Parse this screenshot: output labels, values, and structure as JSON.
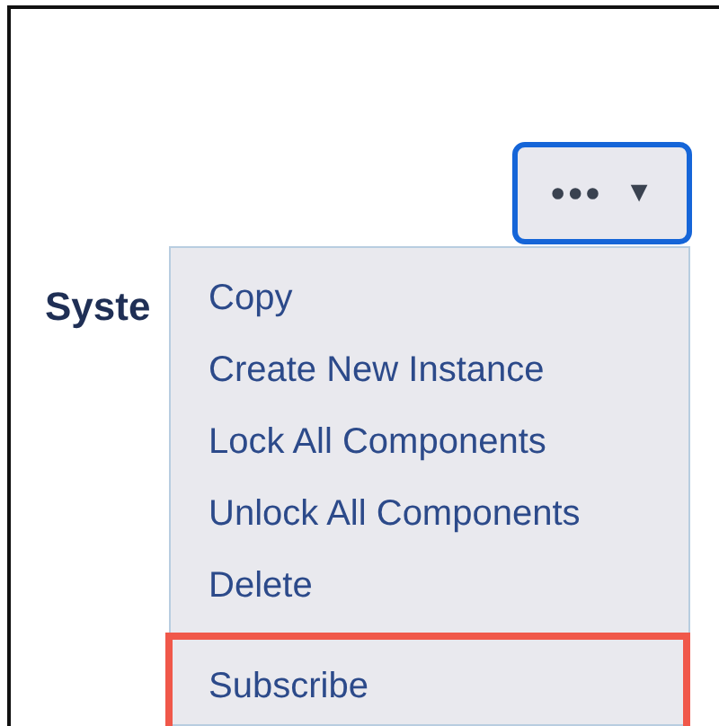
{
  "actions_button": {
    "label": "•••",
    "caret": "▼",
    "focused": true
  },
  "section": {
    "title": "Syste"
  },
  "menu": {
    "items": [
      {
        "label": "Copy",
        "highlighted": false
      },
      {
        "label": "Create New Instance",
        "highlighted": false
      },
      {
        "label": "Lock All Components",
        "highlighted": false
      },
      {
        "label": "Unlock All Components",
        "highlighted": false
      },
      {
        "label": "Delete",
        "highlighted": false
      },
      {
        "label": "Subscribe",
        "highlighted": true
      }
    ]
  }
}
